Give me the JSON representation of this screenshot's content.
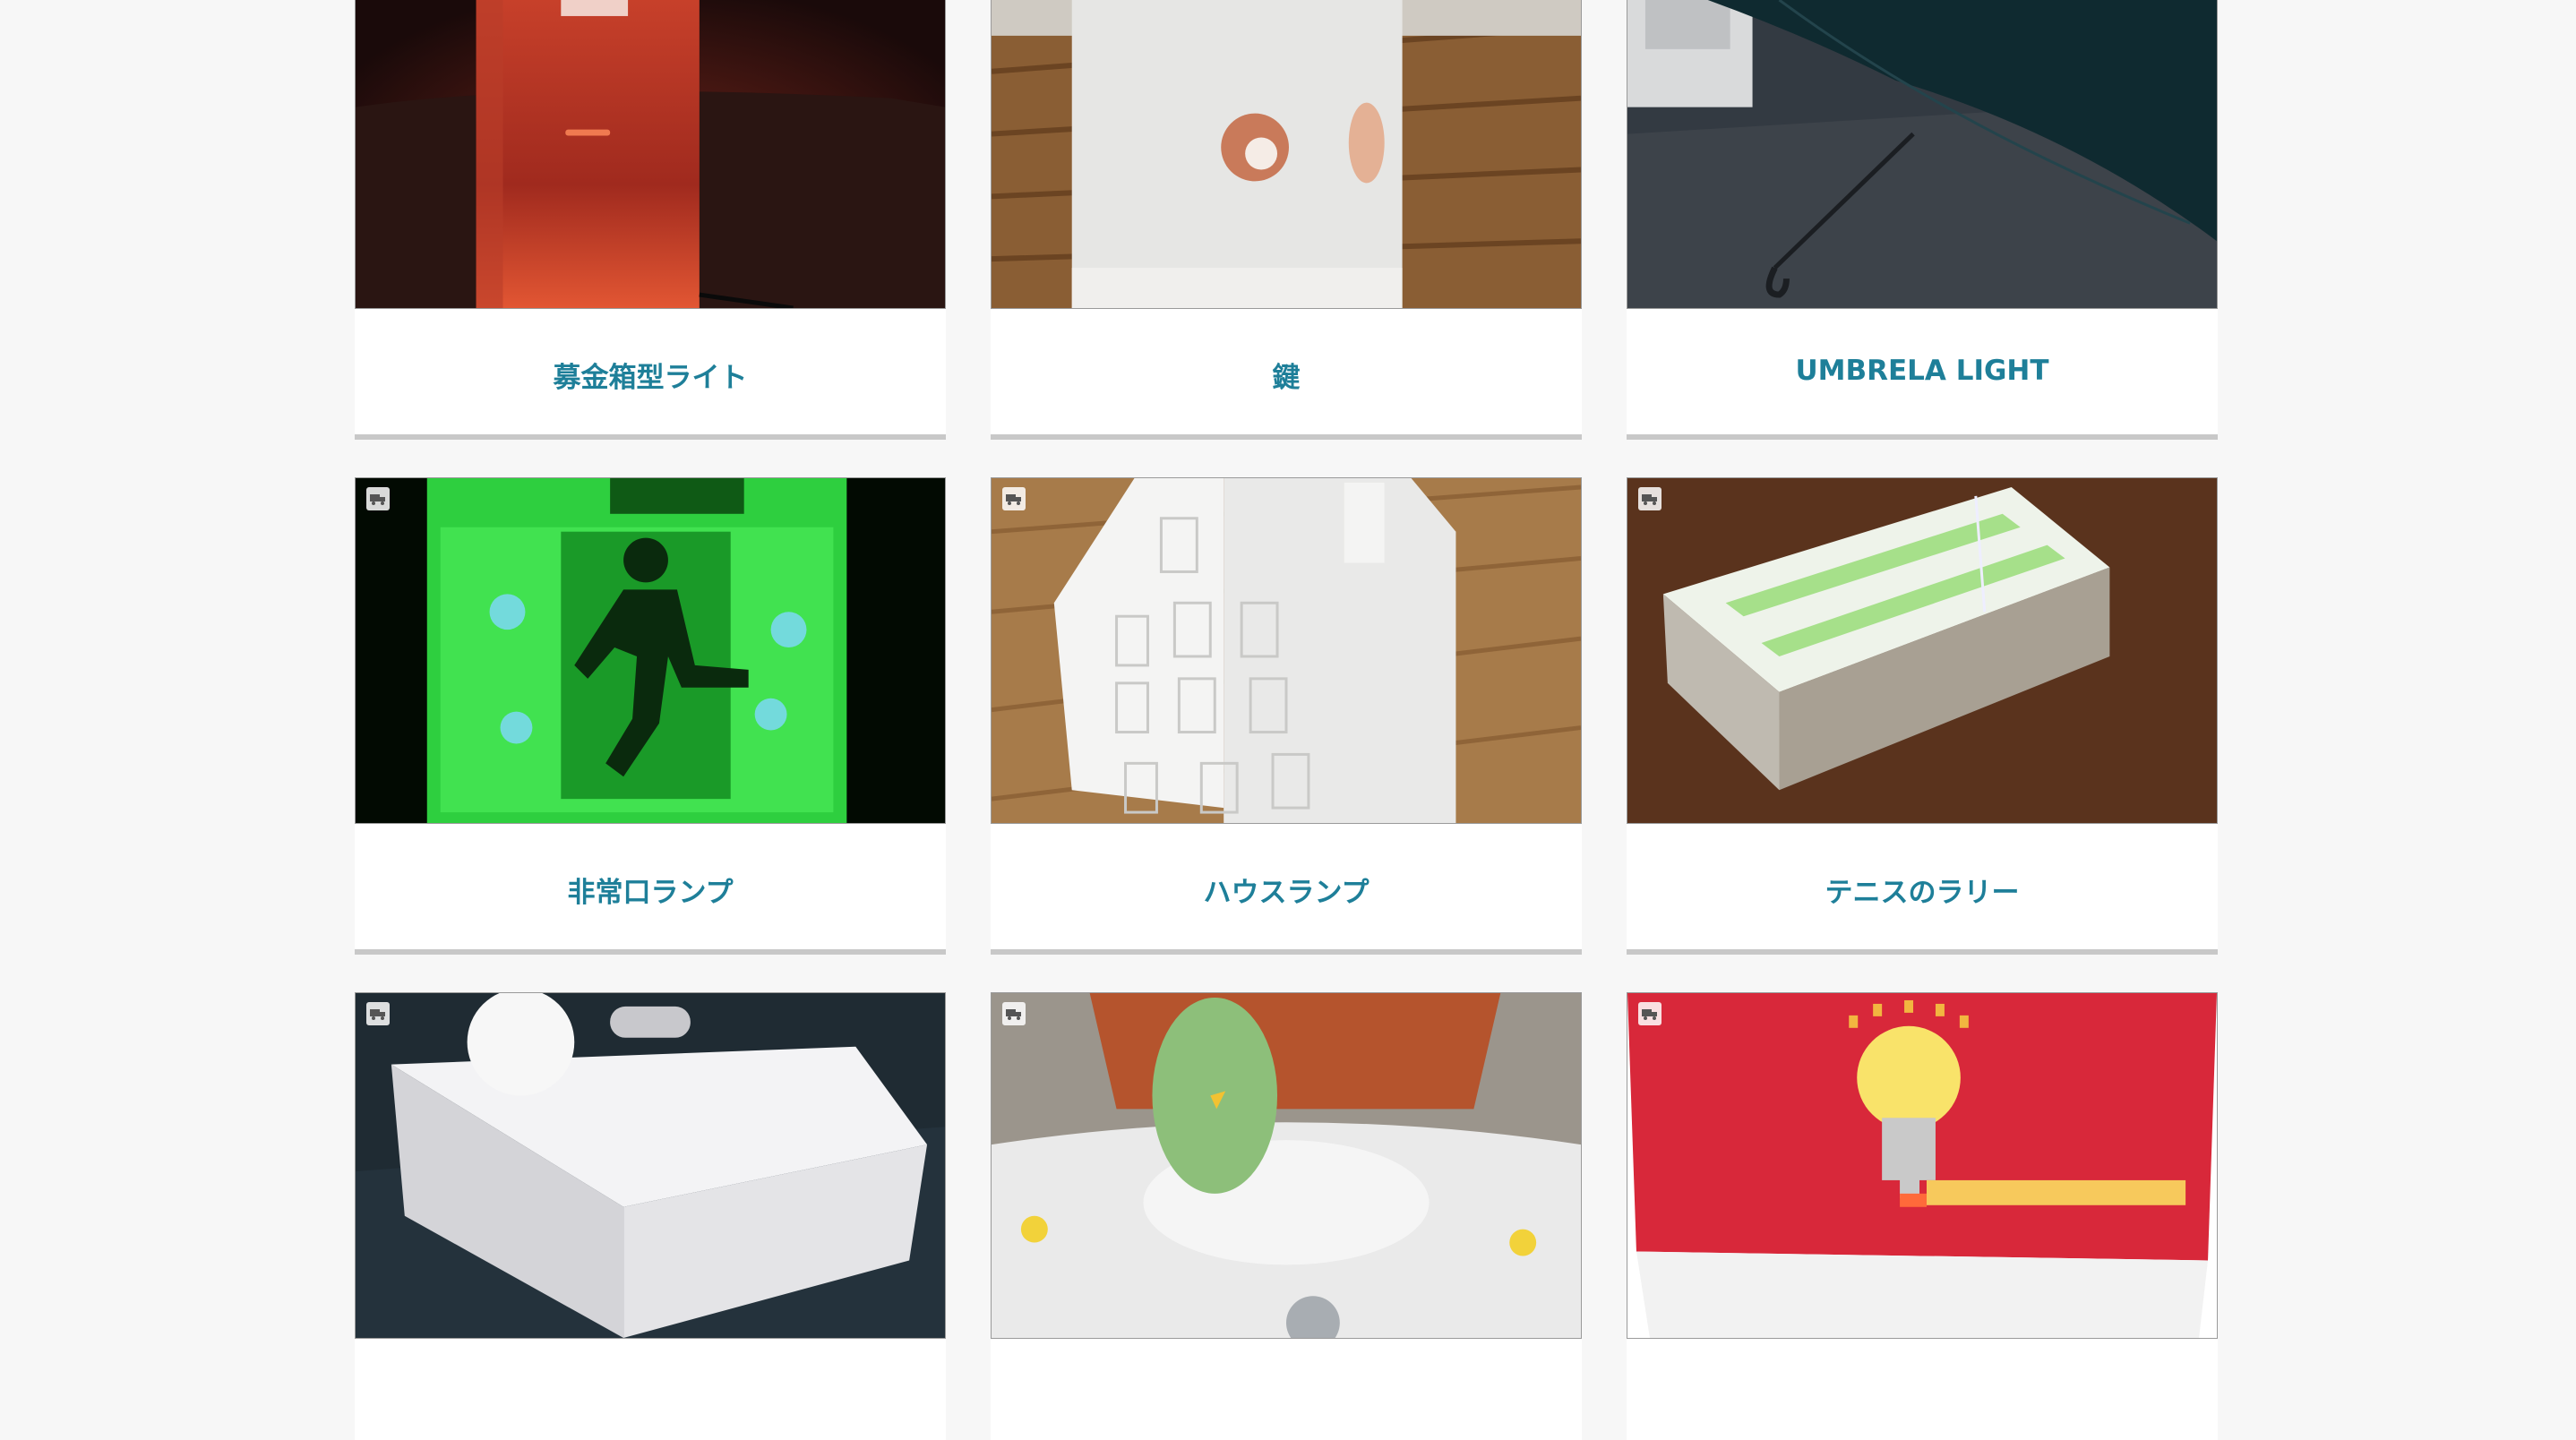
{
  "cards": [
    {
      "title": "募金箱型ライト",
      "image": "red-light-box-photo"
    },
    {
      "title": "鍵",
      "image": "frosted-acrylic-key-photo"
    },
    {
      "title": "UMBRELA LIGHT",
      "image": "umbrella-photo"
    },
    {
      "title": "非常口ランプ",
      "image": "green-exit-sign-photo"
    },
    {
      "title": "ハウスランプ",
      "image": "white-house-lamp-photo"
    },
    {
      "title": "テニスのラリー",
      "image": "tennis-court-box-photo"
    },
    {
      "title": "",
      "image": "white-box-ping-pong-photo"
    },
    {
      "title": "",
      "image": "green-bird-flower-lamp-photo"
    },
    {
      "title": "",
      "image": "red-lightbulb-box-photo"
    }
  ],
  "colors": {
    "title": "#1e7f99",
    "background": "#f7f7f7",
    "card": "#ffffff",
    "underline": "#c8c8c8"
  }
}
